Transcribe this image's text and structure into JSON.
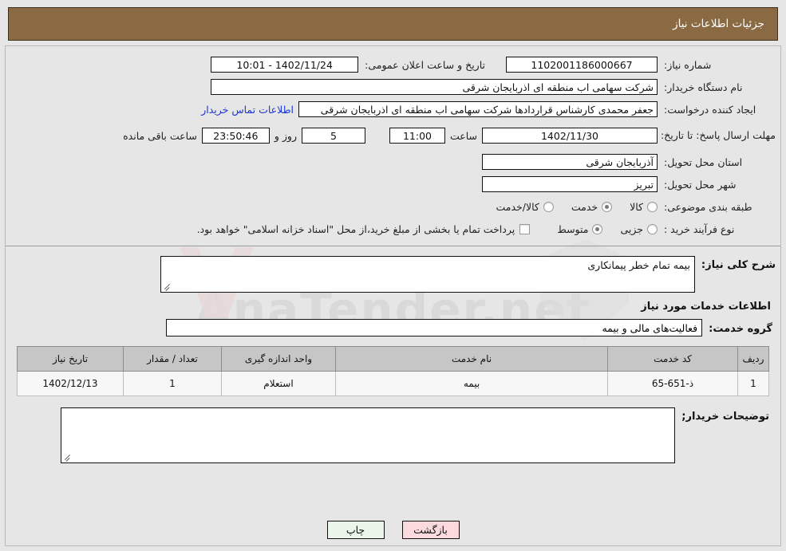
{
  "header": {
    "title": "جزئیات اطلاعات نیاز"
  },
  "watermark": {
    "text": "AnaTender.net",
    "mark": "V"
  },
  "top": {
    "need_number_label": "شماره نیاز:",
    "need_number_value": "1102001186000667",
    "announce_label": "تاریخ و ساعت اعلان عمومی:",
    "announce_value": "10:01 - 1402/11/24",
    "buyer_org_label": "نام دستگاه خریدار:",
    "buyer_org_value": "شرکت سهامی اب منطقه ای اذربایجان شرقی",
    "creator_label": "ایجاد کننده درخواست:",
    "creator_value": "جعفر محمدی کارشناس قراردادها شرکت سهامی اب منطقه ای اذربایجان شرقی",
    "contact_link": "اطلاعات تماس خریدار",
    "deadline_label": "مهلت ارسال پاسخ: تا تاریخ:",
    "deadline_date": "1402/11/30",
    "deadline_hour_label": "ساعت",
    "deadline_hour": "11:00",
    "remaining_days": "5",
    "remaining_days_suffix": "روز و",
    "remaining_time": "23:50:46",
    "remaining_time_suffix": "ساعت باقی مانده",
    "province_label": "استان محل تحویل:",
    "province_value": "آذربایجان شرقی",
    "city_label": "شهر محل تحویل:",
    "city_value": "تبریز",
    "category_label": "طبقه بندی موضوعی:",
    "category_options": [
      {
        "label": "کالا",
        "checked": false
      },
      {
        "label": "خدمت",
        "checked": true
      },
      {
        "label": "کالا/خدمت",
        "checked": false
      }
    ],
    "process_label": "نوع فرآیند خرید :",
    "process_options": [
      {
        "label": "جزیی",
        "checked": false
      },
      {
        "label": "متوسط",
        "checked": true
      }
    ],
    "treasury_checkbox_label": "پرداخت تمام یا بخشی از مبلغ خرید،از محل \"اسناد خزانه اسلامی\" خواهد بود.",
    "treasury_checked": false
  },
  "middle": {
    "general_desc_label": "شرح کلی نیاز:",
    "general_desc_value": "بیمه تمام خطر پیمانکاری",
    "services_info_heading": "اطلاعات خدمات مورد نیاز",
    "service_group_label": "گروه خدمت:",
    "service_group_value": "فعالیت‌های مالی و بیمه"
  },
  "table": {
    "headers": [
      "ردیف",
      "کد خدمت",
      "نام خدمت",
      "واحد اندازه گیری",
      "تعداد / مقدار",
      "تاریخ نیاز"
    ],
    "rows": [
      {
        "radif": "1",
        "code": "ذ-651-65",
        "name": "بیمه",
        "unit": "استعلام",
        "qty": "1",
        "date": "1402/12/13"
      }
    ]
  },
  "notes": {
    "label": "توضیحات خریدار;",
    "value": ""
  },
  "footer": {
    "print_label": "چاپ",
    "back_label": "بازگشت"
  },
  "colors": {
    "header_bg": "#8a6a43",
    "link": "#1a36d0",
    "print_btn_bg": "#eaf6ea",
    "back_btn_bg": "#fadadd",
    "table_header_bg": "#c6c6c6"
  }
}
